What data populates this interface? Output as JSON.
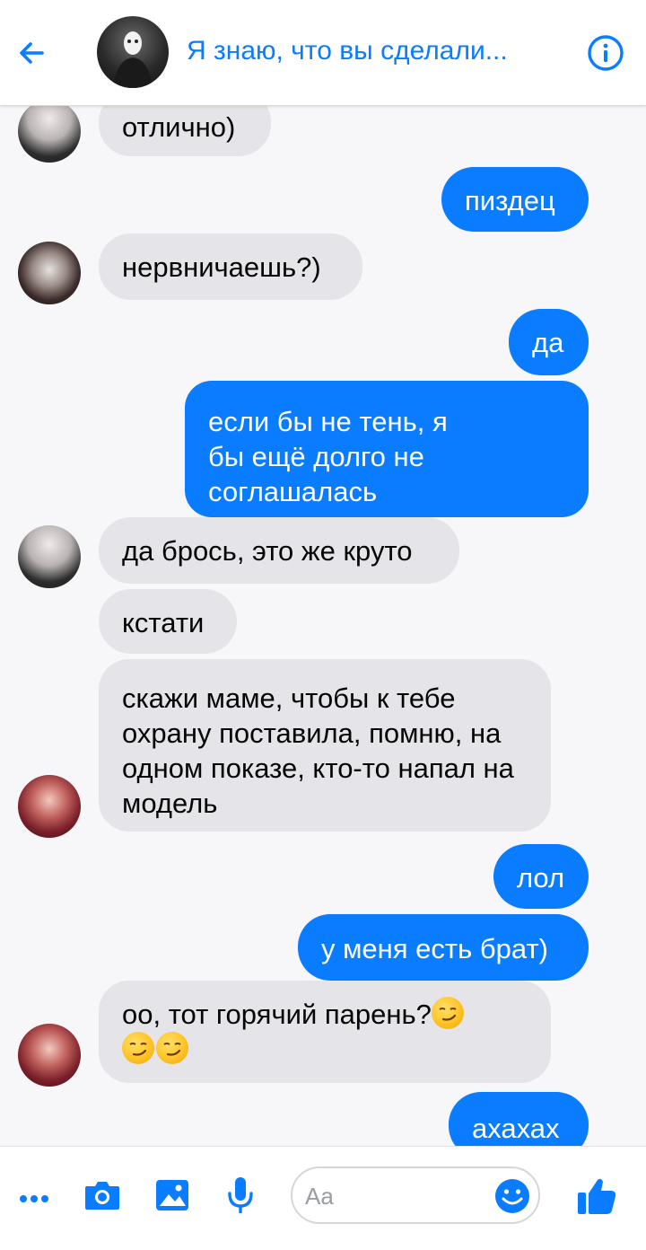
{
  "header": {
    "title": "Я знаю, что вы сделали...",
    "back_icon": "arrow-left-icon",
    "info_icon": "info-icon"
  },
  "theme": {
    "accent": "#0a7cff",
    "incoming_bubble": "#e4e4e9",
    "background": "#f7f7fa"
  },
  "messages": [
    {
      "direction": "in",
      "text": "отлично)"
    },
    {
      "direction": "out",
      "text": "пиздец"
    },
    {
      "direction": "in",
      "text": "нервничаешь?)"
    },
    {
      "direction": "out",
      "text": "да"
    },
    {
      "direction": "out",
      "text": "если бы не тень, я бы ещё долго не соглашалась"
    },
    {
      "direction": "in",
      "text": "да брось, это же круто"
    },
    {
      "direction": "in",
      "text": "кстати"
    },
    {
      "direction": "in",
      "text": "скажи маме, чтобы к тебе охрану поставила, помню, на одном показе, кто-то напал на модель"
    },
    {
      "direction": "out",
      "text": "лол"
    },
    {
      "direction": "out",
      "text": "у меня есть брат)"
    },
    {
      "direction": "in",
      "text": "оо, тот горячий парень?",
      "emoji": "smirk-emoji x3"
    },
    {
      "direction": "out",
      "text": "ахахах"
    }
  ],
  "composer": {
    "placeholder": "Aa"
  },
  "toolbar": {
    "icons": [
      "more-icon",
      "camera-icon",
      "image-icon",
      "microphone-icon",
      "emoji-icon",
      "thumbs-up-icon"
    ]
  }
}
